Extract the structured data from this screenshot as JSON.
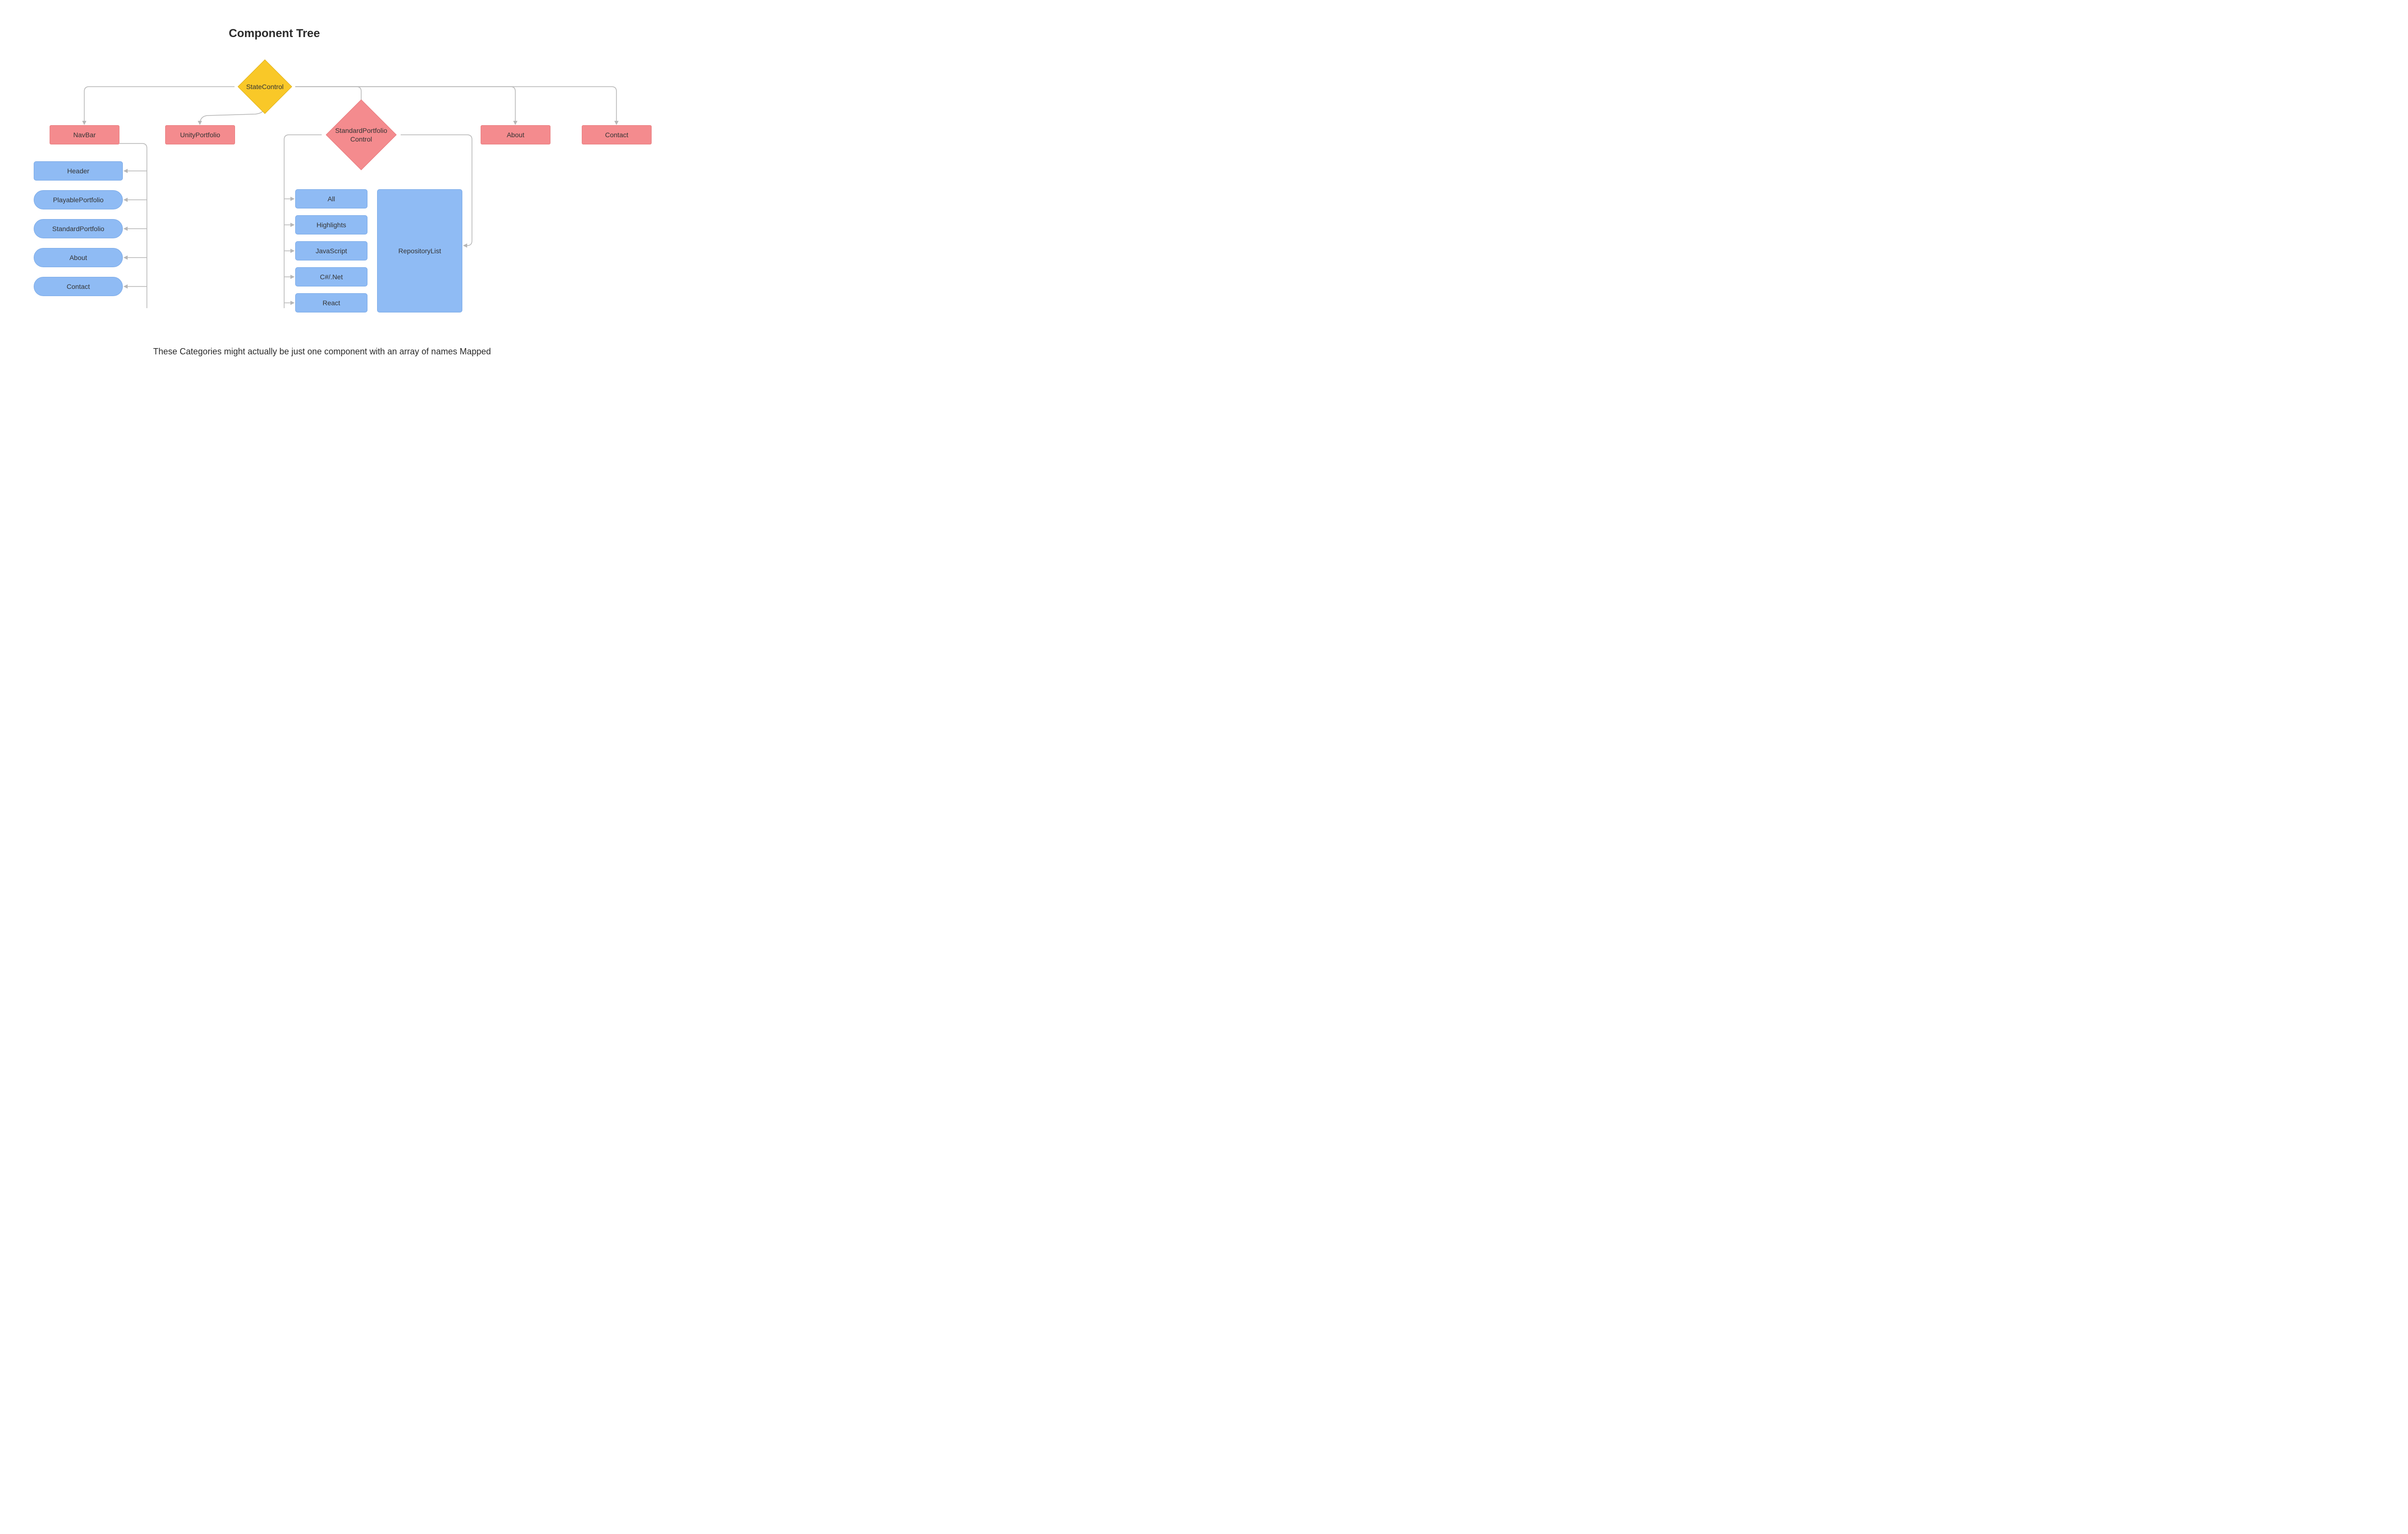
{
  "title": "Component Tree",
  "footnote": "These Categories  might actually be just one component with an array of names Mapped",
  "root": {
    "label": "StateControl"
  },
  "level2": {
    "navbar": "NavBar",
    "unity": "UnityPortfolio",
    "standard": "StandardPortfolio Control",
    "about": "About",
    "contact": "Contact"
  },
  "navbar_children": {
    "header": "Header",
    "playable": "PlayablePortfolio",
    "standard": "StandardPortfolio",
    "about": "About",
    "contact": "Contact"
  },
  "standard_children": {
    "all": "All",
    "highlights": "Highlights",
    "javascript": "JavaScript",
    "csharp": "C#/.Net",
    "react": "React",
    "repolist": "RepositoryList"
  }
}
